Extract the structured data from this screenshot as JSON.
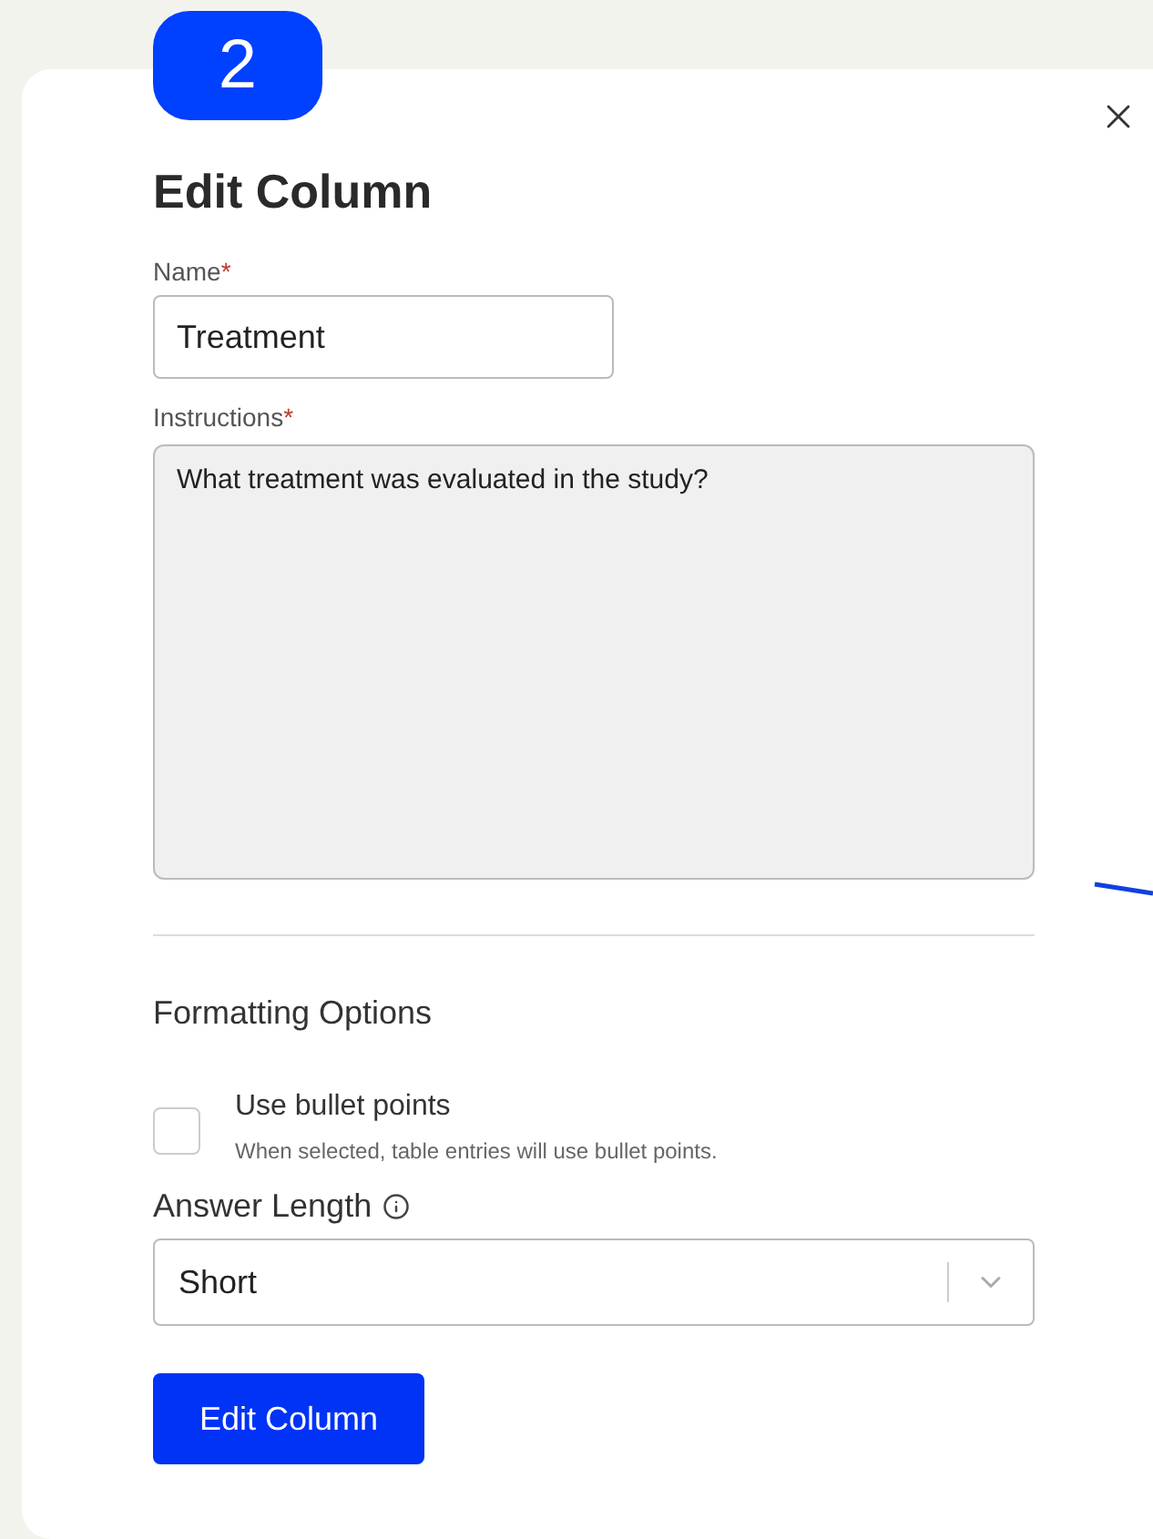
{
  "badge": "2",
  "dialog": {
    "title": "Edit Column"
  },
  "name_field": {
    "label": "Name",
    "required": "*",
    "value": "Treatment"
  },
  "instructions_field": {
    "label": "Instructions",
    "required": "*",
    "value": "What treatment was evaluated in the study?"
  },
  "section_title": "Formatting Options",
  "bullet_option": {
    "label": "Use bullet points",
    "help": "When selected, table entries will use bullet points.",
    "checked": false
  },
  "answer_length": {
    "label": "Answer Length",
    "value": "Short"
  },
  "submit": "Edit Column"
}
